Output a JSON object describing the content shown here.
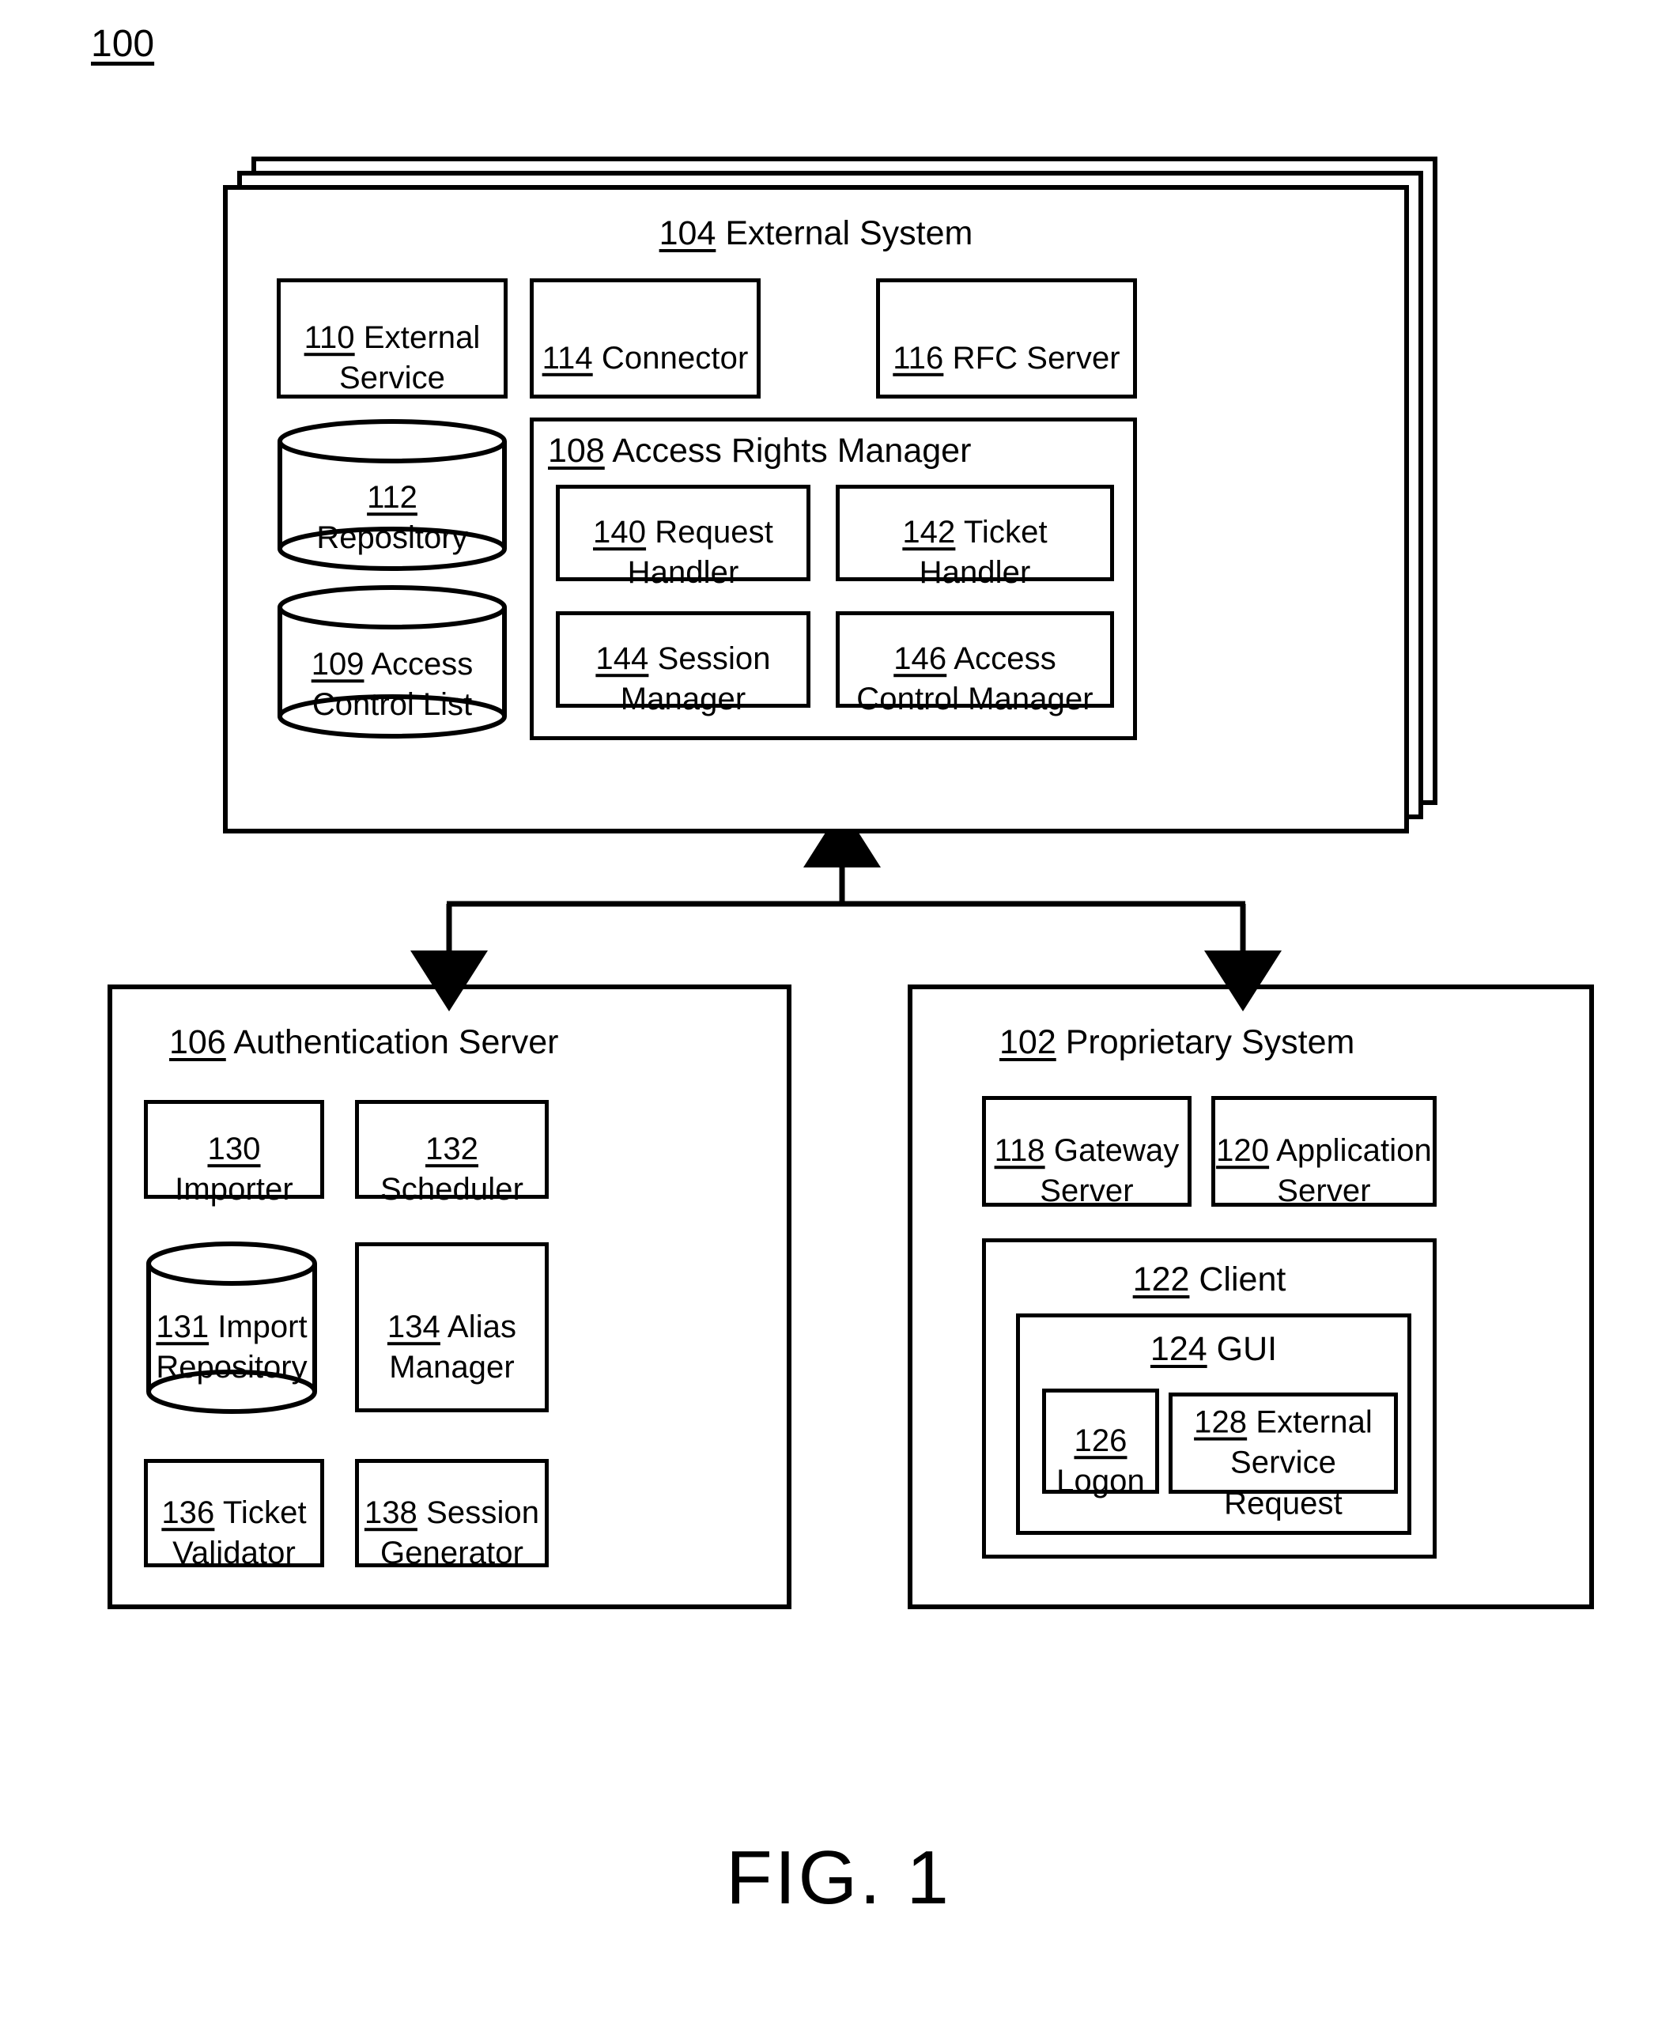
{
  "figure": {
    "number": "100",
    "caption": "FIG. 1"
  },
  "external_system": {
    "ref": "104",
    "label": "External System",
    "stack_layers": 3,
    "children": [
      {
        "ref": "110",
        "label": "External\nService",
        "shape": "rect"
      },
      {
        "ref": "114",
        "label": "Connector",
        "shape": "rect"
      },
      {
        "ref": "116",
        "label": "RFC Server",
        "shape": "rect"
      },
      {
        "ref": "112",
        "label": "Repository",
        "shape": "cylinder"
      },
      {
        "ref": "109",
        "label": "Access\nControl List",
        "shape": "cylinder"
      }
    ],
    "access_rights_manager": {
      "ref": "108",
      "label": "Access Rights Manager",
      "children": [
        {
          "ref": "140",
          "label": "Request\nHandler"
        },
        {
          "ref": "142",
          "label": "Ticket\nHandler"
        },
        {
          "ref": "144",
          "label": "Session\nManager"
        },
        {
          "ref": "146",
          "label": "Access\nControl Manager"
        }
      ]
    }
  },
  "authentication_server": {
    "ref": "106",
    "label": "Authentication Server",
    "children": [
      {
        "ref": "130",
        "label": "Importer",
        "shape": "rect"
      },
      {
        "ref": "132",
        "label": "Scheduler",
        "shape": "rect"
      },
      {
        "ref": "131",
        "label": "Import\nRepository",
        "shape": "cylinder"
      },
      {
        "ref": "134",
        "label": "Alias\nManager",
        "shape": "rect"
      },
      {
        "ref": "136",
        "label": "Ticket\nValidator",
        "shape": "rect"
      },
      {
        "ref": "138",
        "label": "Session\nGenerator",
        "shape": "rect"
      }
    ]
  },
  "proprietary_system": {
    "ref": "102",
    "label": "Proprietary System",
    "children": [
      {
        "ref": "118",
        "label": "Gateway\nServer"
      },
      {
        "ref": "120",
        "label": "Application\nServer"
      }
    ],
    "client": {
      "ref": "122",
      "label": "Client",
      "gui": {
        "ref": "124",
        "label": "GUI",
        "children": [
          {
            "ref": "126",
            "label": "Logon"
          },
          {
            "ref": "128",
            "label": "External\nService Request"
          }
        ]
      }
    }
  },
  "colors": {
    "stroke": "#000000",
    "background": "#ffffff"
  }
}
